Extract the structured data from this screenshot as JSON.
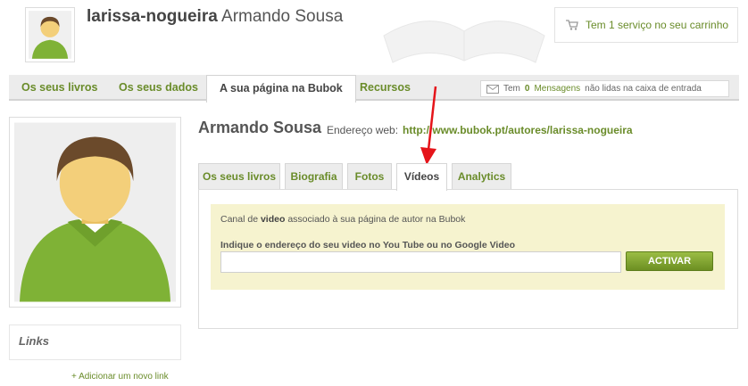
{
  "header": {
    "login": "larissa-nogueira",
    "full_name": "Armando Sousa",
    "cart_text": "Tem 1 serviço no seu carrinho"
  },
  "nav": {
    "items": [
      {
        "label": "Os seus livros"
      },
      {
        "label": "Os seus dados"
      },
      {
        "label": "A sua página na Bubok",
        "active": true
      },
      {
        "label": "Recursos"
      }
    ]
  },
  "inbox": {
    "prefix": "Tem",
    "count": "0",
    "link": "Mensagens",
    "suffix": "não lidas na caixa de entrada"
  },
  "profile": {
    "name": "Armando Sousa",
    "web_label": "Endereço web:",
    "web_url": "http://www.bubok.pt/autores/larissa-nogueira"
  },
  "tabs": [
    {
      "label": "Os seus livros"
    },
    {
      "label": "Biografia"
    },
    {
      "label": "Fotos"
    },
    {
      "label": "Vídeos",
      "active": true
    },
    {
      "label": "Analytics"
    }
  ],
  "video": {
    "desc_prefix": "Canal de",
    "desc_bold": "video",
    "desc_suffix": "associado à sua página de autor na Bubok",
    "label": "Indique o endereço do seu video no You Tube ou no Google Video",
    "input_value": "",
    "button": "ACTIVAR"
  },
  "sidebar": {
    "links_title": "Links",
    "add_link": "+ Adicionar um novo link"
  },
  "colors": {
    "accent": "#6a8c2a",
    "arrow": "#e5141a"
  }
}
